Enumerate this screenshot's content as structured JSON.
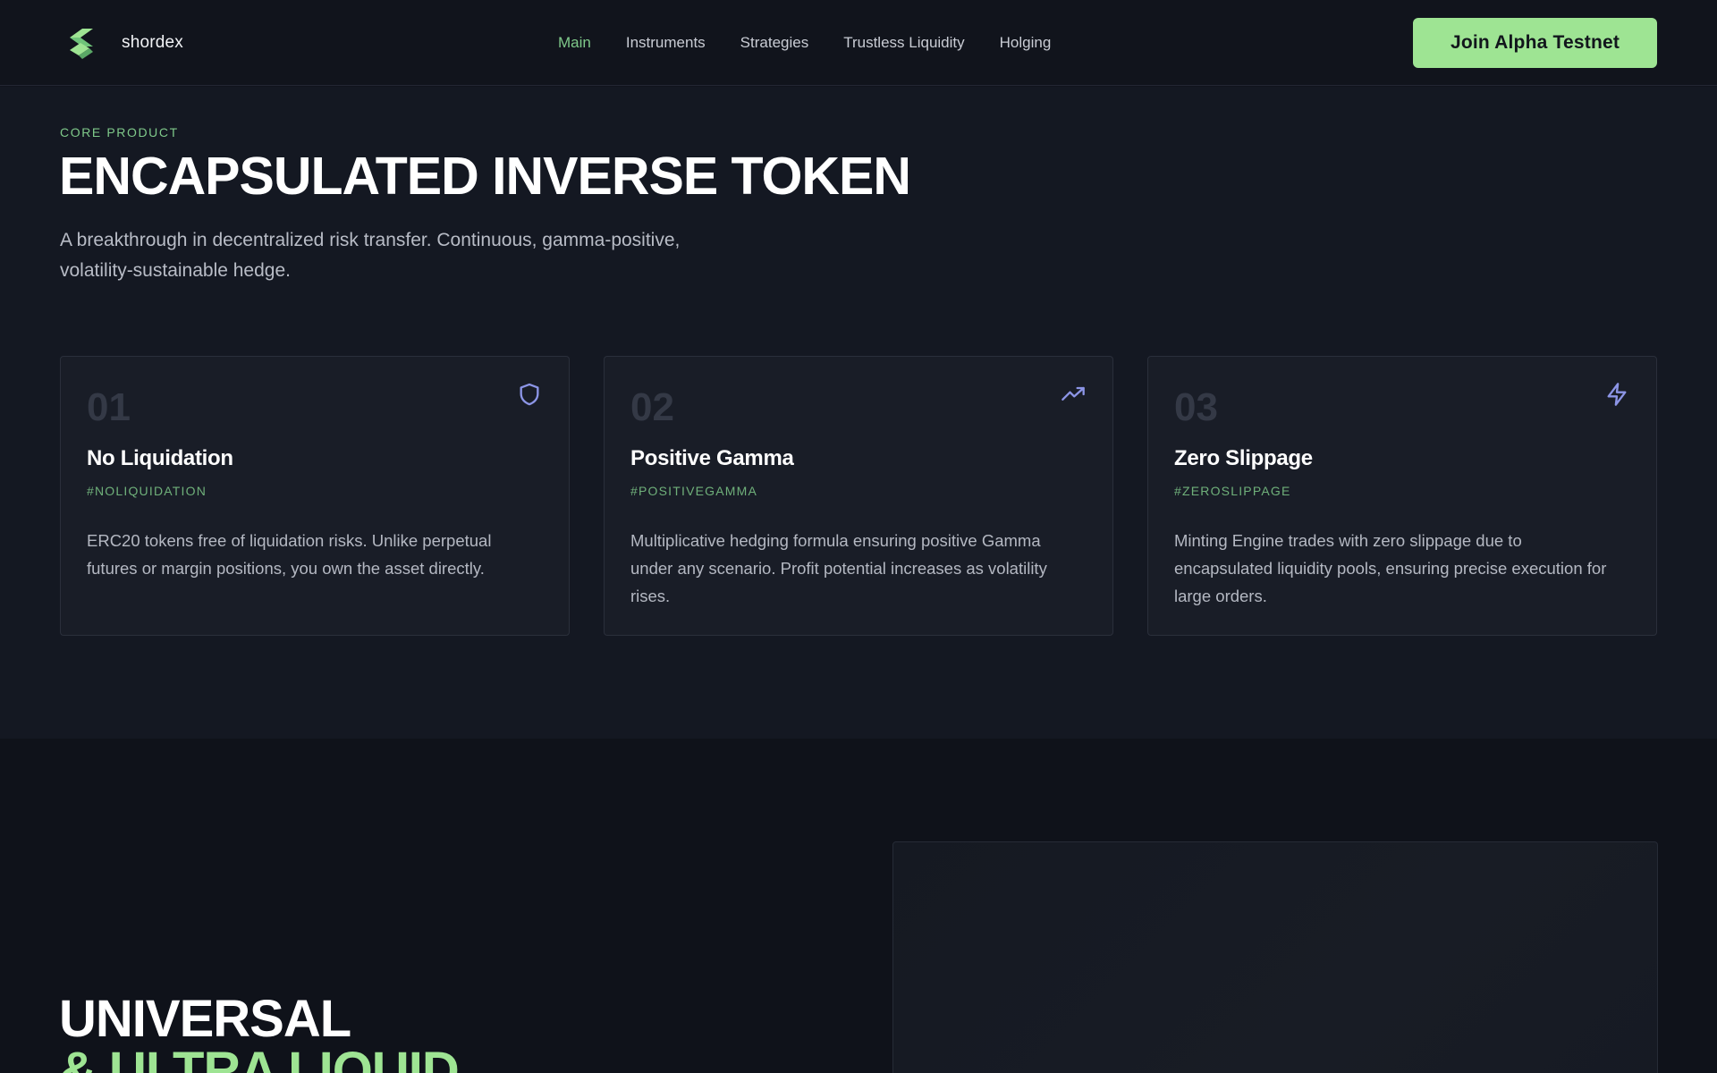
{
  "header": {
    "brand": "shordex",
    "nav": [
      {
        "label": "Main",
        "active": true
      },
      {
        "label": "Instruments",
        "active": false
      },
      {
        "label": "Strategies",
        "active": false
      },
      {
        "label": "Trustless Liquidity",
        "active": false
      },
      {
        "label": "Holging",
        "active": false
      }
    ],
    "cta_label": "Join Alpha Testnet"
  },
  "core": {
    "eyebrow": "CORE PRODUCT",
    "title": "ENCAPSULATED INVERSE TOKEN",
    "subtitle": "A breakthrough in decentralized risk transfer. Continuous, gamma-positive, volatility-sustainable hedge.",
    "cards": [
      {
        "number": "01",
        "icon": "shield-icon",
        "title": "No Liquidation",
        "tag": "#NOLIQUIDATION",
        "body": "ERC20 tokens free of liquidation risks. Unlike perpetual futures or margin positions, you own the asset directly."
      },
      {
        "number": "02",
        "icon": "trending-up-icon",
        "title": "Positive Gamma",
        "tag": "#POSITIVEGAMMA",
        "body": "Multiplicative hedging formula ensuring positive Gamma under any scenario. Profit potential increases as volatility rises."
      },
      {
        "number": "03",
        "icon": "lightning-icon",
        "title": "Zero Slippage",
        "tag": "#ZEROSLIPPAGE",
        "body": "Minting Engine trades with zero slippage due to encapsulated liquidity pools, ensuring precise execution for large orders."
      }
    ]
  },
  "lower": {
    "title_line1": "UNIVERSAL",
    "title_line2": "& ULTRA LIQUID"
  },
  "colors": {
    "accent": "#9ee493",
    "accent_text": "#7fc98a",
    "icon": "#8c95e6",
    "background": "#11141c"
  }
}
